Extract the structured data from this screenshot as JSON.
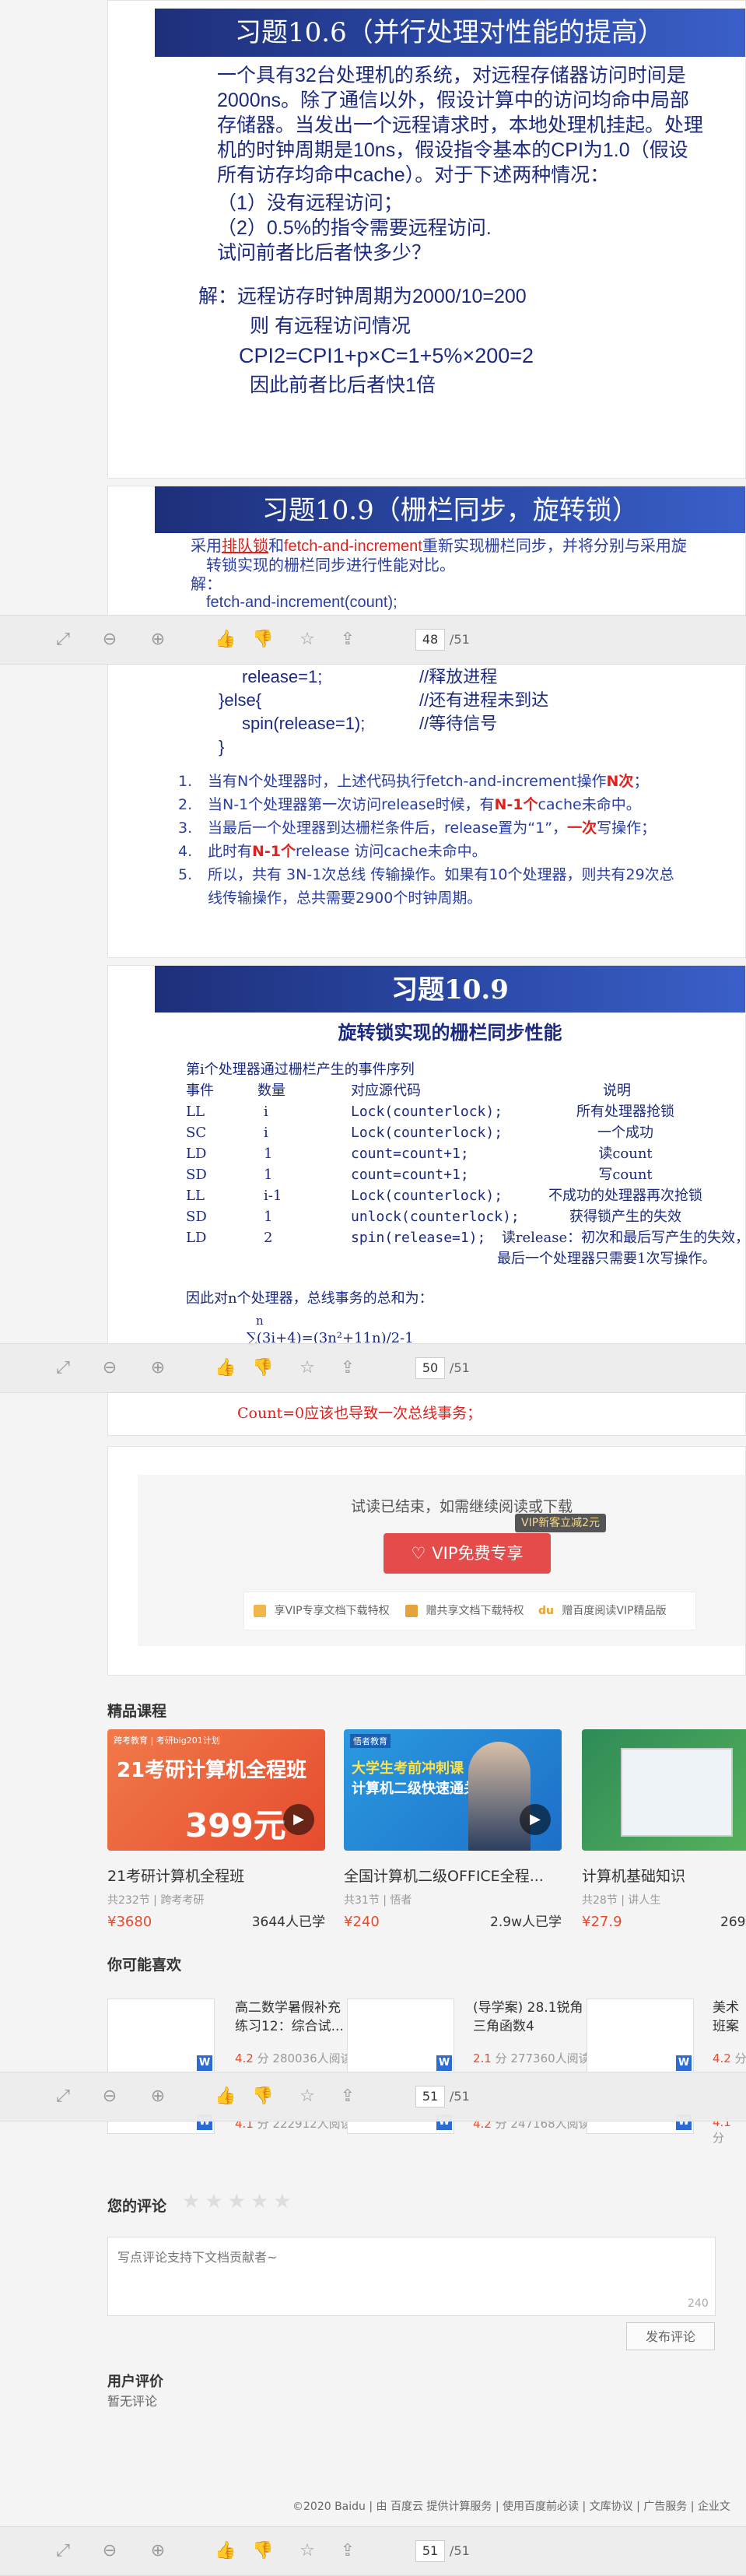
{
  "slide1": {
    "title": "习题10.6（并行处理对性能的提高）",
    "lines": [
      "一个具有32台处理机的系统，对远程存储器访问时间是",
      "2000ns。除了通信以外，假设计算中的访问均命中局部",
      "存储器。当发出一个远程请求时，本地处理机挂起。处理",
      "机的时钟周期是10ns，假设指令基本的CPI为1.0（假设",
      "所有访存均命中cache）。对于下述两种情况："
    ],
    "case1": "（1）没有远程访问；",
    "case2": "（2）0.5%的指令需要远程访问.",
    "question": "试问前者比后者快多少？",
    "answer_label": "解：",
    "answer1": "远程访存时钟周期为2000/10=200",
    "answer2": "则 有远程访问情况",
    "answer3": "CPI2=CPI1+p×C=1+5%×200=2",
    "answer4": "因此前者比后者快1倍"
  },
  "slide2": {
    "title": "习题10.9（栅栏同步，旋转锁）",
    "intro_pre": "采用",
    "intro_link": "排队锁",
    "intro_mid": "和",
    "intro_red": "fetch-and-increment",
    "intro_post": "重新实现栅栏同步，并将分别与采用旋",
    "intro_line2": "转锁实现的栅栏同步进行性能对比。",
    "sol": "解：",
    "code_cut": "fetch-and-increment(count);",
    "code": [
      {
        "code": "release=1;",
        "comment": "//释放进程"
      },
      {
        "code": "}else{",
        "comment": "//还有进程未到达"
      },
      {
        "code": "spin(release=1);",
        "comment": "//等待信号"
      },
      {
        "code": "}",
        "comment": ""
      }
    ],
    "items": [
      {
        "num": "1.",
        "pre": "当有N个处理器时，上述代码执行fetch-and-increment操作",
        "red": "N次",
        "post": "；"
      },
      {
        "num": "2.",
        "pre": "当N-1个处理器第一次访问release时候，有",
        "red": "N-1个",
        "post": "cache未命中。"
      },
      {
        "num": "3.",
        "pre": "当最后一个处理器到达栅栏条件后，release置为“1”，",
        "red": "一次",
        "post": "写操作；"
      },
      {
        "num": "4.",
        "pre": "此时有",
        "red": "N-1个",
        "post": "release 访问cache未命中。"
      },
      {
        "num": "5.",
        "pre": "所以，共有 3N-1次总线 传输操作。如果有10个处理器，则共有29次总",
        "red": "",
        "post": ""
      }
    ],
    "item5_line2": "线传输操作，总共需要2900个时钟周期。"
  },
  "slide3": {
    "title": "习题10.9",
    "subtitle": "旋转锁实现的栅栏同步性能",
    "seq_title": "第i个处理器通过栅栏产生的事件序列",
    "headers": [
      "事件",
      "数量",
      "对应源代码",
      "说明"
    ],
    "rows": [
      [
        "LL",
        "i",
        "Lock(counterlock);",
        "所有处理器抢锁"
      ],
      [
        "SC",
        "i",
        "Lock(counterlock);",
        "一个成功"
      ],
      [
        "LD",
        "1",
        "count=count+1;",
        "读count"
      ],
      [
        "SD",
        "1",
        "count=count+1;",
        "写count"
      ],
      [
        "LL",
        "i-1",
        "Lock(counterlock);",
        "不成功的处理器再次抢锁"
      ],
      [
        "SD",
        "1",
        "unlock(counterlock);",
        "获得锁产生的失效"
      ],
      [
        "LD",
        "2",
        "spin(release=1);",
        "读release：初次和最后写产生的失效，"
      ]
    ],
    "last_note": "最后一个处理器只需要1次写操作。",
    "sum_text": "因此对n个处理器，总线事务的总和为：",
    "sum_n": "n",
    "sum_formula": "∑(3i+4)=(3n²+11n)/2-1",
    "count_note": "Count=0应该也导致一次总线事务；"
  },
  "toolbars": [
    {
      "current": "48",
      "total": "/51"
    },
    {
      "current": "50",
      "total": "/51"
    },
    {
      "current": "51",
      "total": "/51"
    },
    {
      "current": "51",
      "total": "/51"
    }
  ],
  "trial": {
    "message": "试读已结束，如需继续阅读或下载",
    "vip_tag": "VIP新客立减2元",
    "vip_button": "VIP免费专享",
    "benefit1": "享VIP专享文档下载特权",
    "benefit2": "赠共享文档下载特权",
    "benefit3": "赠百度阅读VIP精品版"
  },
  "courses": {
    "heading": "精品课程",
    "items": [
      {
        "name": "21考研计算机全程班",
        "meta": "共232节 | 跨考考研",
        "price": "¥3680",
        "learners": "3644人已学",
        "banner": "21考研计算机全程班",
        "banner_price": "399元",
        "tag": "跨考教育 | 考研big201计划"
      },
      {
        "name": "全国计算机二级OFFICE全程...",
        "meta": "共31节 | 悟者",
        "price": "¥240",
        "learners": "2.9w人已学",
        "banner": "大学生考前冲刺课",
        "banner2": "计算机二级快速通关",
        "tag": "悟者教育"
      },
      {
        "name": "计算机基础知识",
        "meta": "共28节 | 讲人生",
        "price": "¥27.9",
        "learners": "269"
      }
    ]
  },
  "recommend": {
    "heading": "你可能喜欢",
    "items": [
      {
        "title": "高二数学暑假补充练习12：综合试...",
        "score": "4.2",
        "reads": "分 280036人阅读"
      },
      {
        "title": "(导学案) 28.1锐角三角函数4",
        "score": "2.1",
        "reads": "分 277360人阅读"
      },
      {
        "title": "美术班案",
        "score": "4.2",
        "reads": "分"
      }
    ],
    "items_row2": [
      {
        "score": "4.1",
        "reads": "分 222912人阅读"
      },
      {
        "score": "4.2",
        "reads": "分 247168人阅读"
      },
      {
        "score": "4.1",
        "reads": "分"
      }
    ]
  },
  "comments": {
    "heading": "您的评论",
    "placeholder": "写点评论支持下文档贡献者~",
    "counter": "240",
    "submit": "发布评论",
    "user_heading": "用户评价",
    "empty": "暂无评论"
  },
  "footer": {
    "text": "©2020 Baidu | 由 百度云 提供计算服务 | 使用百度前必读 | 文库协议 | 广告服务 | 企业文"
  },
  "colors": {
    "title_bar": "#1e2f7a",
    "slide_text": "#1b2a80",
    "accent_red": "#e0201c",
    "vip_button": "#e64b4b",
    "price": "#e64b2e"
  }
}
